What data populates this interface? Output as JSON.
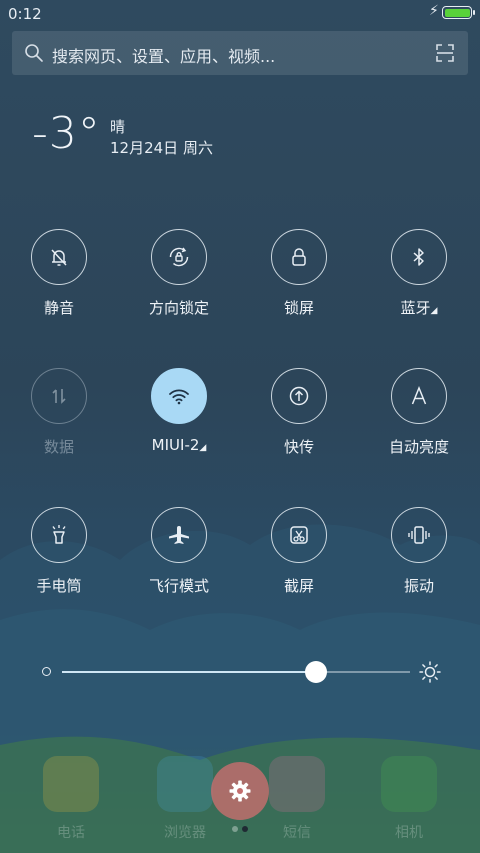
{
  "status_bar": {
    "time": "0:12"
  },
  "search": {
    "placeholder": "搜索网页、设置、应用、视频..."
  },
  "weather": {
    "temperature": "-3°",
    "condition": "晴",
    "date": "12月24日 周六"
  },
  "toggles": [
    {
      "label": "静音",
      "icon": "bell-off-icon",
      "state": "off"
    },
    {
      "label": "方向锁定",
      "icon": "rotation-lock-icon",
      "state": "off"
    },
    {
      "label": "锁屏",
      "icon": "lock-icon",
      "state": "off"
    },
    {
      "label": "蓝牙",
      "icon": "bluetooth-icon",
      "state": "off",
      "expandable": true
    },
    {
      "label": "数据",
      "icon": "data-arrows-icon",
      "state": "disabled"
    },
    {
      "label": "MIUI-2",
      "icon": "wifi-icon",
      "state": "on",
      "expandable": true
    },
    {
      "label": "快传",
      "icon": "fast-share-icon",
      "state": "off"
    },
    {
      "label": "自动亮度",
      "icon": "auto-brightness-icon",
      "state": "off"
    },
    {
      "label": "手电筒",
      "icon": "flashlight-icon",
      "state": "off"
    },
    {
      "label": "飞行模式",
      "icon": "airplane-icon",
      "state": "off"
    },
    {
      "label": "截屏",
      "icon": "screenshot-icon",
      "state": "off"
    },
    {
      "label": "振动",
      "icon": "vibrate-icon",
      "state": "off"
    }
  ],
  "brightness": {
    "level": 0.73
  },
  "dock": {
    "apps": [
      {
        "label": "电话",
        "icon": "phone-app-icon",
        "color": "#e8b93a"
      },
      {
        "label": "浏览器",
        "icon": "browser-app-icon",
        "color": "#4aa6d8"
      },
      {
        "label": "短信",
        "icon": "messages-app-icon",
        "color": "#e26ea3"
      },
      {
        "label": "相机",
        "icon": "camera-app-icon",
        "color": "#4cb84c"
      }
    ],
    "settings_icon": "gear-icon",
    "pages": {
      "count": 2,
      "current": 2
    }
  },
  "colors": {
    "accent_active": "#a9d9f5",
    "battery": "#59d23a",
    "settings_button": "#c46e6e"
  }
}
